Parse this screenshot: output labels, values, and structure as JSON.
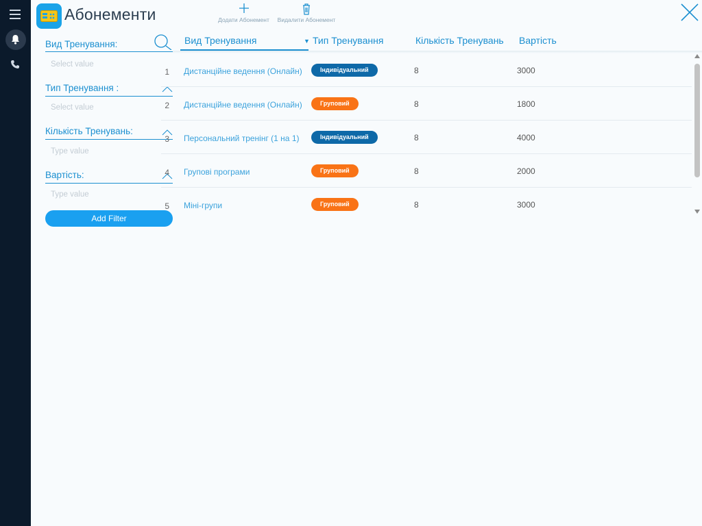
{
  "app": {
    "title": "Абонементи"
  },
  "toolbar": {
    "add_label": "Додати Абонемент",
    "delete_label": "Видалити Абонемент"
  },
  "filters": [
    {
      "label": "Вид Тренування:",
      "placeholder": "Select value"
    },
    {
      "label": "Тип Тренування :",
      "placeholder": "Select value"
    },
    {
      "label": "Кількість Тренувань:",
      "placeholder": "Type value"
    },
    {
      "label": "Вартість:",
      "placeholder": "Type value"
    }
  ],
  "add_filter_label": "Add Filter",
  "table": {
    "columns": [
      "Вид Тренування",
      "Тип Тренування",
      "Кількість Тренувань",
      "Вартість"
    ],
    "rows": [
      {
        "num": "1",
        "name": "Дистанційне ведення (Онлайн)",
        "type": "Індивідуальний",
        "count": "8",
        "price": "3000"
      },
      {
        "num": "2",
        "name": "Дистанційне ведення (Онлайн)",
        "type": "Груповий",
        "count": "8",
        "price": "1800"
      },
      {
        "num": "3",
        "name": "Персональний тренінг (1 на 1)",
        "type": "Індивідуальний",
        "count": "8",
        "price": "4000"
      },
      {
        "num": "4",
        "name": "Групові програми",
        "type": "Груповий",
        "count": "8",
        "price": "2000"
      },
      {
        "num": "5",
        "name": "Міні-групи",
        "type": "Груповий",
        "count": "8",
        "price": "3000"
      }
    ]
  },
  "colors": {
    "accent": "#1b8fd0",
    "badge_individual": "#0e69a8",
    "badge_group": "#f97316",
    "rail": "#0b1a2b"
  },
  "icons": [
    "menu-icon",
    "bell-icon",
    "phone-icon",
    "ticket-icon",
    "plus-icon",
    "trash-icon",
    "close-icon",
    "search-icon",
    "chevron-up-icon"
  ]
}
